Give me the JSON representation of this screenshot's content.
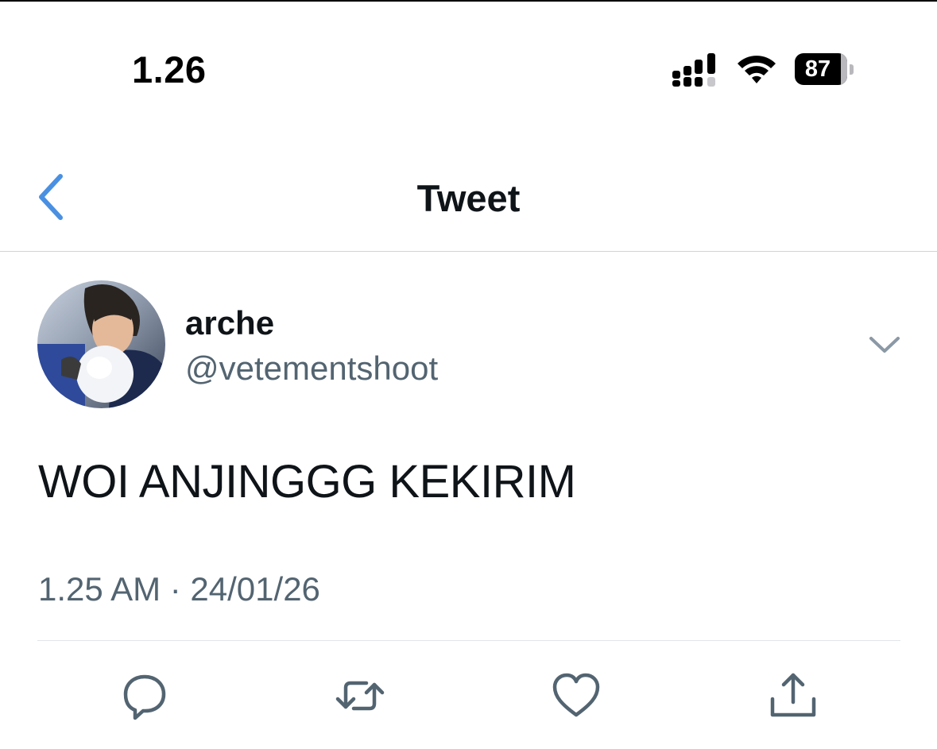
{
  "status_bar": {
    "time": "1.26",
    "battery_percent": "87",
    "icons": [
      "signal-icon",
      "wifi-icon",
      "battery-icon"
    ]
  },
  "nav": {
    "title": "Tweet",
    "back_icon": "chevron-left-icon"
  },
  "tweet": {
    "author_name": "arche",
    "author_handle": "@vetementshoot",
    "text": "WOI ANJINGGG KEKIRIM",
    "timestamp": "1.25 AM · 24/01/26"
  },
  "actions": [
    "reply-icon",
    "retweet-icon",
    "like-icon",
    "share-icon"
  ],
  "colors": {
    "accent": "#4a90e2",
    "text_primary": "#0f1419",
    "text_secondary": "#536471",
    "icon_gray": "#536471",
    "divider": "#cfd4d9"
  }
}
